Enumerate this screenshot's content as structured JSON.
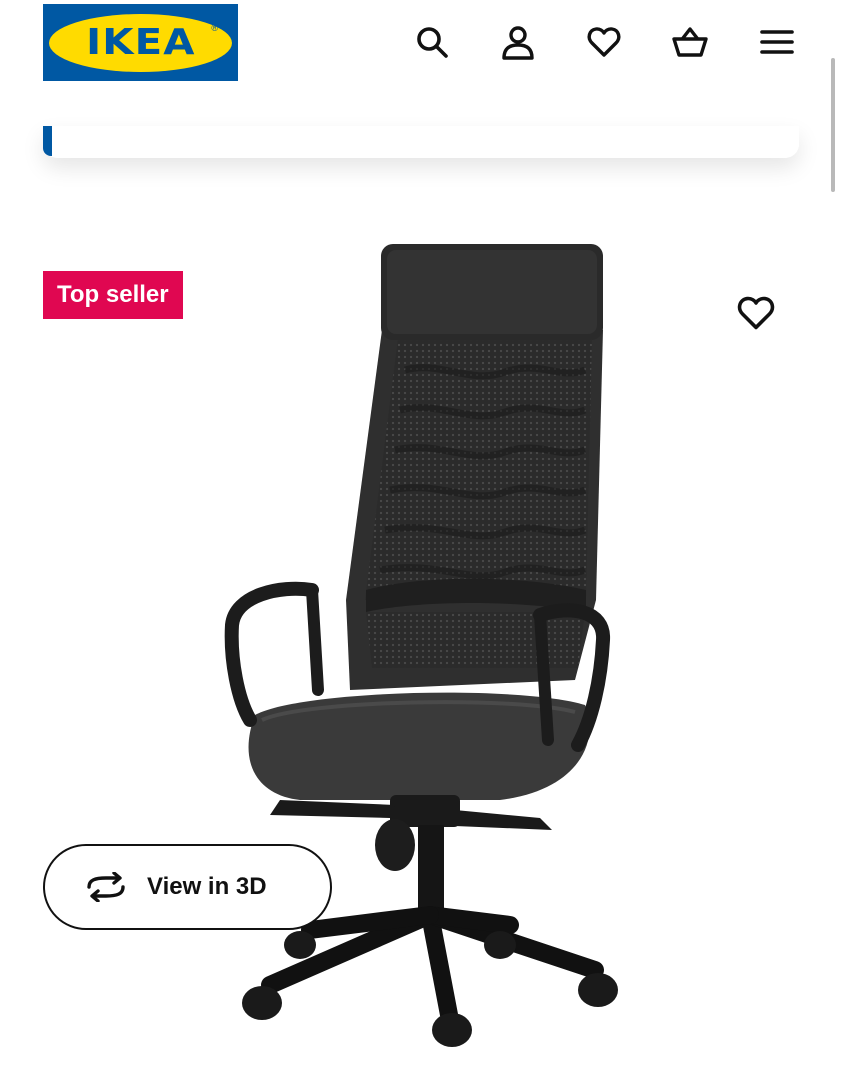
{
  "header": {
    "logo_text": "IKEA",
    "logo_mark": "®",
    "icons": [
      "search-icon",
      "account-icon",
      "heart-icon",
      "basket-icon",
      "menu-icon"
    ]
  },
  "product": {
    "badge": "Top seller",
    "view_3d_label": "View in 3D",
    "image_alt": "office chair",
    "fav_icon": "heart-icon"
  },
  "colors": {
    "brand_blue": "#0058a3",
    "brand_yellow": "#ffdb00",
    "badge_red": "#e00751",
    "text": "#111111"
  }
}
